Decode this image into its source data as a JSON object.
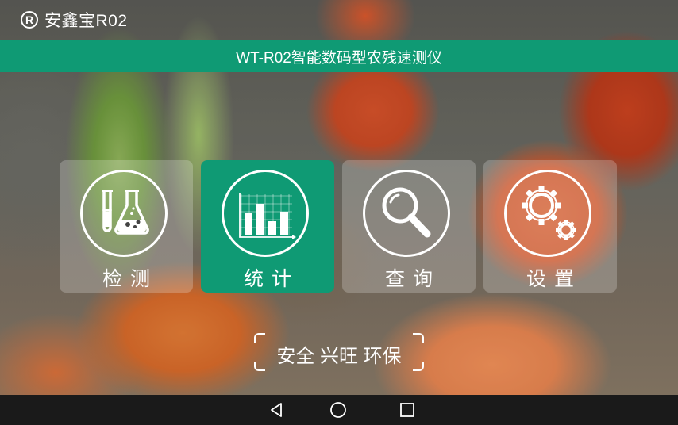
{
  "brand": {
    "name": "安鑫宝R02",
    "registered_mark": "R"
  },
  "title_bar": {
    "title": "WT-R02智能数码型农残速测仪"
  },
  "menu": [
    {
      "label": "检测",
      "icon": "test-tube-flask-icon",
      "active": false
    },
    {
      "label": "统计",
      "icon": "bar-chart-icon",
      "active": true
    },
    {
      "label": "查询",
      "icon": "magnifier-icon",
      "active": false
    },
    {
      "label": "设置",
      "icon": "gears-icon",
      "active": false
    }
  ],
  "slogan": {
    "text": "安全 兴旺 环保"
  },
  "navbar": {
    "back": "back-icon",
    "home": "home-icon",
    "recents": "recents-icon"
  },
  "colors": {
    "accent": "#0f9a74",
    "nav_bg": "#1a1a1a"
  }
}
